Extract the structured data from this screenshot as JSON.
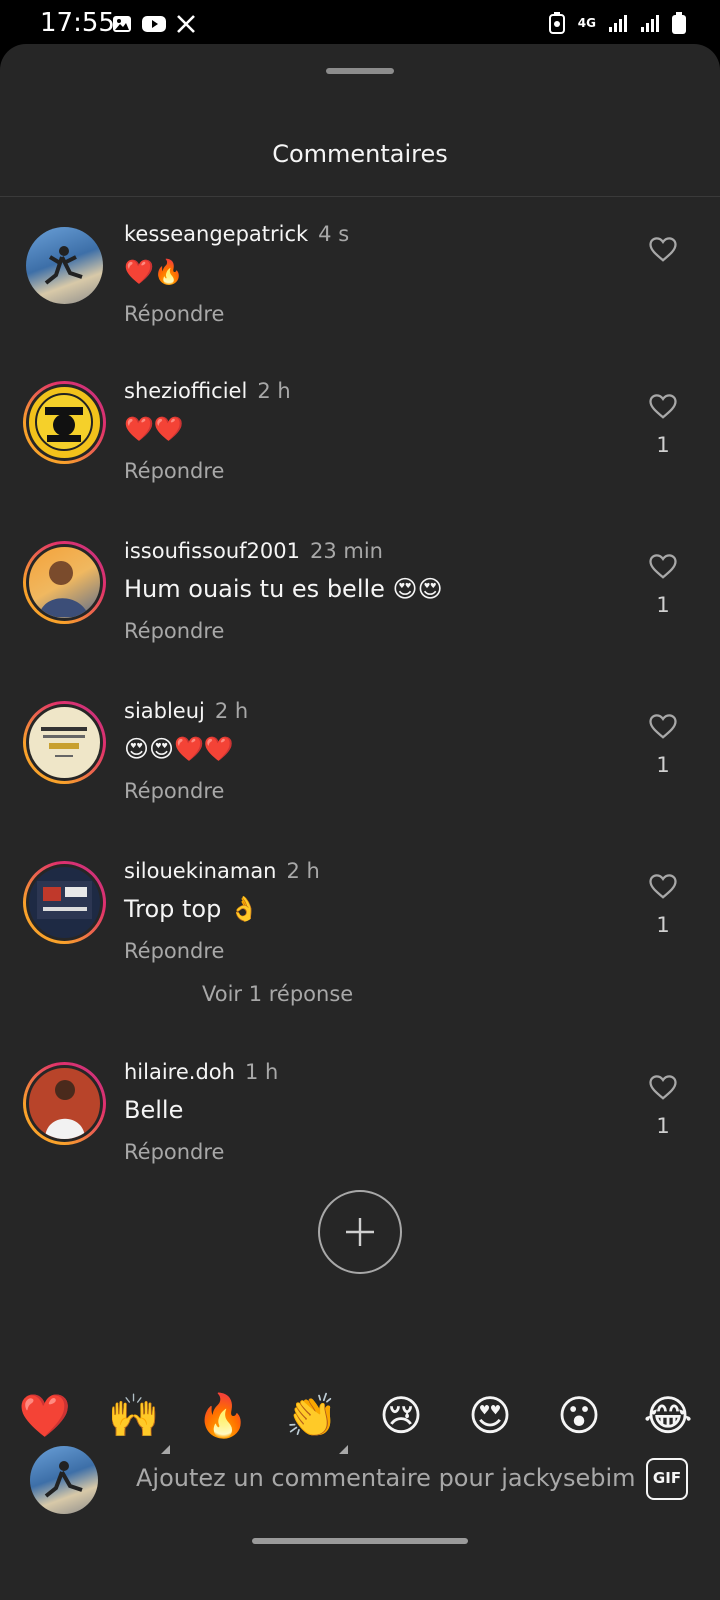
{
  "status_bar": {
    "time": "17:55",
    "left_icons": [
      "gallery-icon",
      "youtube-icon",
      "x-icon"
    ],
    "right_icons": [
      "battery-saver-icon",
      "network-4g-icon",
      "signal-icon",
      "signal-icon",
      "battery-icon"
    ],
    "network_label": "4G"
  },
  "sheet": {
    "title": "Commentaires"
  },
  "comments": [
    {
      "username": "kesseangepatrick",
      "time": "4 s",
      "text": "❤️🔥",
      "reply_label": "Répondre",
      "likes": "",
      "avatar_ring": false
    },
    {
      "username": "sheziofficiel",
      "time": "2 h",
      "text": "❤️❤️",
      "reply_label": "Répondre",
      "likes": "1",
      "avatar_ring": true
    },
    {
      "username": "issoufissouf2001",
      "time": "23 min",
      "text": "Hum ouais tu es belle 😍😍",
      "reply_label": "Répondre",
      "likes": "1",
      "avatar_ring": true
    },
    {
      "username": "siableuj",
      "time": "2 h",
      "text": "😍😍❤️❤️",
      "reply_label": "Répondre",
      "likes": "1",
      "avatar_ring": true
    },
    {
      "username": "silouekinaman",
      "time": "2 h",
      "text": "Trop top 👌",
      "reply_label": "Répondre",
      "likes": "1",
      "avatar_ring": true
    },
    {
      "username": "hilaire.doh",
      "time": "1 h",
      "text": "Belle",
      "reply_label": "Répondre",
      "likes": "1",
      "avatar_ring": true
    }
  ],
  "view_replies": "Voir 1 réponse",
  "quick_reactions": [
    "❤️",
    "🙌",
    "🔥",
    "👏",
    "😢",
    "😍",
    "😮",
    "😂"
  ],
  "compose": {
    "placeholder": "Ajoutez un commentaire pour jackysebim",
    "gif_label": "GIF"
  },
  "colors": {
    "sheet_bg": "#262626",
    "secondary_text": "#a8a8a8",
    "story_ring_start": "#f9a22b",
    "story_ring_end": "#c13584"
  }
}
